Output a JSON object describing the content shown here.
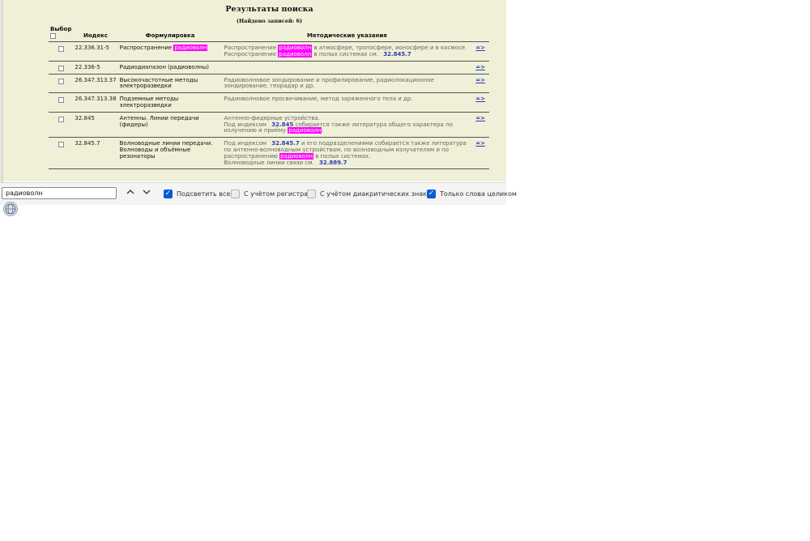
{
  "page": {
    "title": "Результаты поиска",
    "count": "(Найдено записей: 6)"
  },
  "table": {
    "headers": {
      "select": "Выбор",
      "index": "Индекс",
      "formulation": "Формулировка",
      "methods": "Методические указания"
    },
    "rows": [
      {
        "index": "22.336.31-5",
        "formulation": [
          "Распространение ",
          {
            "hl": "радиоволн"
          }
        ],
        "methods": [
          [
            "Распространение ",
            {
              "hl": "радиоволн"
            },
            " в атмосфере, тропосфере, ионосфере и в космосе."
          ],
          [
            "Распространение ",
            {
              "hl": "радиоволн"
            },
            " в полых системах см. ",
            {
              "ref": "32.845.7"
            }
          ]
        ],
        "link": "=>"
      },
      {
        "index": "22.336-5",
        "formulation": [
          "Радиодиапазон (радиоволны)"
        ],
        "methods": [],
        "link": "=>"
      },
      {
        "index": "26.347.313.37",
        "formulation": [
          "Высокочастотные методы электроразведки"
        ],
        "methods": [
          [
            "Радиоволновое зондирование и профилирование, радиолокационное зондирование, георадар и др."
          ]
        ],
        "link": "=>"
      },
      {
        "index": "26.347.313.38",
        "formulation": [
          "Подземные методы электроразведки"
        ],
        "methods": [
          [
            "Радиоволновое просвечивание, метод заряженного тела и др."
          ]
        ],
        "link": "=>"
      },
      {
        "index": "32.845",
        "formulation": [
          "Антенны. Линии передачи (фидеры)"
        ],
        "methods": [
          [
            "Антенно-фидерные устройства."
          ],
          [
            "Под индексом ",
            {
              "ref": "32.845"
            },
            " собирается также литература общего характера по излучению и приёму ",
            {
              "hl": "радиоволн"
            },
            "."
          ]
        ],
        "link": "=>"
      },
      {
        "index": "32.845.7",
        "formulation": [
          "Волноводные линии передачи. Волноводы и объёмные резонаторы"
        ],
        "methods": [
          [
            "Под индексом ",
            {
              "ref": "32.845.7"
            },
            " и его подразделениями собирается также литература по антенно-волноводным устройствам, по волноводным излучателям и по распространению ",
            {
              "hl": "радиоволн"
            },
            " в полых системах."
          ],
          [
            "Волноводные линии связи см. ",
            {
              "ref": "32.889.7"
            }
          ]
        ],
        "link": "=>"
      }
    ]
  },
  "findbar": {
    "query": "радиоволн",
    "up_icon": "chevron-up-icon",
    "down_icon": "chevron-down-icon",
    "options": [
      {
        "label": "Подсветить все",
        "checked": true
      },
      {
        "label": "С учётом регистра",
        "checked": false
      },
      {
        "label": "С учётом диакритических знаков",
        "checked": false
      },
      {
        "label": "Только слова целиком",
        "checked": true
      }
    ]
  },
  "colors": {
    "panel_bg": "#f0f0d8",
    "highlight": "#ff00ff",
    "link": "#2a40b0",
    "checkbox_on": "#0a5bd6"
  }
}
